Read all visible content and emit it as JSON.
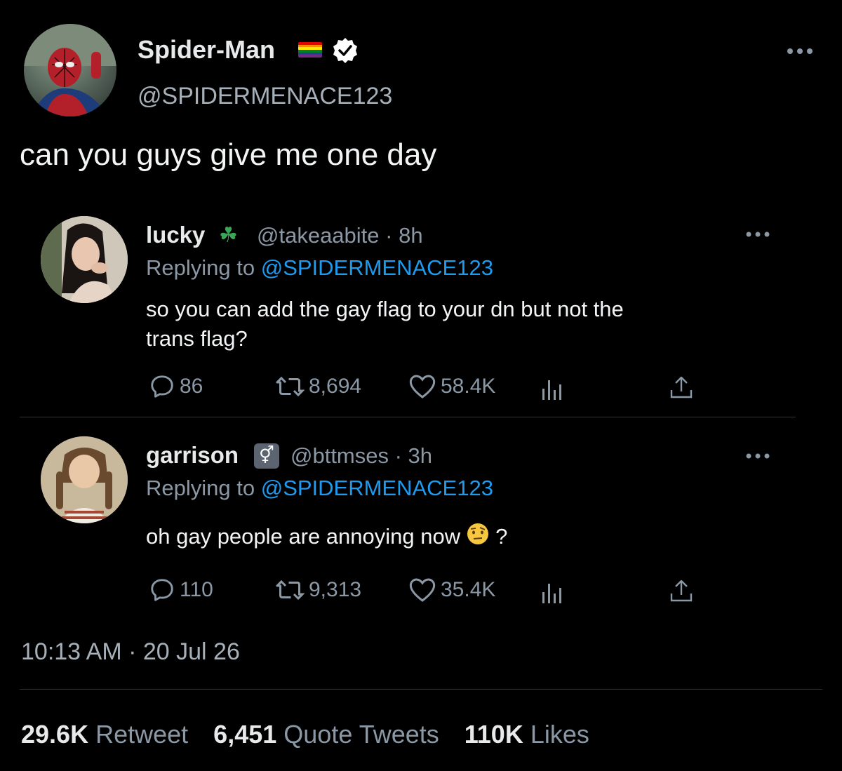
{
  "tweet": {
    "author_name": "Spider-Man",
    "author_handle": "@SPIDERMENACE123",
    "text": "can you guys give me one day",
    "timestamp": "10:13 AM · 20 Jul 26",
    "more_icon": "more-horizontal-icon",
    "stats": {
      "retweets_count": "29.6K",
      "retweets_label": "Retweet",
      "quotes_count": "6,451",
      "quotes_label": "Quote Tweets",
      "likes_count": "110K",
      "likes_label": "Likes"
    }
  },
  "replies": [
    {
      "name": "lucky",
      "emoji": "☘",
      "handle": "@takeaabite",
      "time": "· 8h",
      "replying_prefix": "Replying to",
      "replying_to": "@SPIDERMENACE123",
      "text_line1": "so you can add the gay flag to your dn but not the",
      "text_line2": "trans flag?",
      "replies": "86",
      "retweets": "8,694",
      "likes": "58.4K"
    },
    {
      "name": "garrison",
      "emoji": "⚥",
      "handle": "@bttmses",
      "time": "· 3h",
      "replying_prefix": "Replying to",
      "replying_to": "@SPIDERMENACE123",
      "text_line1": "oh gay people are annoying now",
      "text_suffix": "?",
      "replies": "110",
      "retweets": "9,313",
      "likes": "35.4K"
    }
  ],
  "colors": {
    "background": "#000000",
    "text": "#e7e9ea",
    "muted": "#8b98a5",
    "link": "#1d9bf0",
    "divider": "#2f3336"
  }
}
